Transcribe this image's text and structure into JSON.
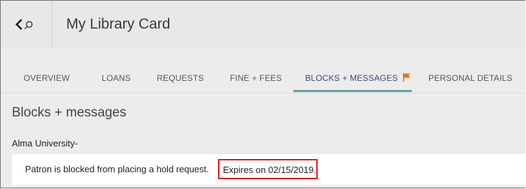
{
  "header": {
    "title": "My Library Card",
    "back_icon": "chevron-left-icon",
    "search_icon": "search-icon"
  },
  "tabs": [
    {
      "label": "OVERVIEW",
      "active": false
    },
    {
      "label": "LOANS",
      "active": false
    },
    {
      "label": "REQUESTS",
      "active": false
    },
    {
      "label": "FINE + FEES",
      "active": false
    },
    {
      "label": "BLOCKS + MESSAGES",
      "active": true,
      "icon": "flag-icon"
    },
    {
      "label": "PERSONAL DETAILS",
      "active": false
    }
  ],
  "colors": {
    "flag": "#e0761a",
    "active_underline": "#5aa3a7",
    "highlight_box": "#e0191b"
  },
  "main": {
    "section_title": "Blocks + messages",
    "institution": "Alma University-",
    "block_message": "Patron is blocked from placing a hold request.",
    "expires_text": "Expires on 02/15/2019."
  }
}
